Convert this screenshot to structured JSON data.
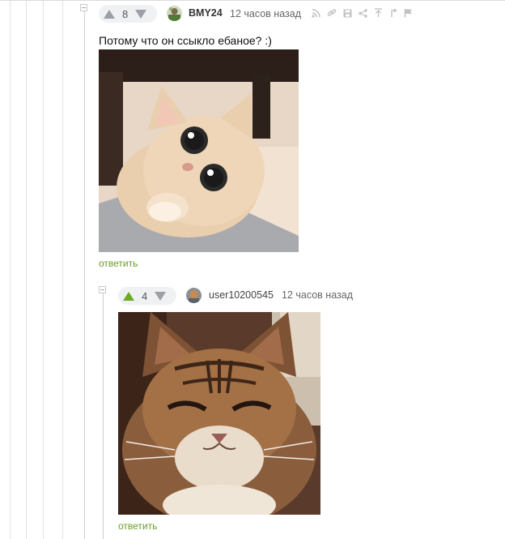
{
  "comments": [
    {
      "rating": "8",
      "username": "BMY24",
      "time": "12 часов назад",
      "text": "Потому что он ссыкло ебаное? :)",
      "image": "photo of a wide-eyed cream kitten peeking from under a chair",
      "reply_label": "ответить"
    },
    {
      "rating": "4",
      "username": "user10200545",
      "time": "12 часов назад",
      "image": "photo of a squinting tabby cat",
      "reply_label": "ответить"
    }
  ],
  "toolbar_icons": [
    "rss-icon",
    "link-icon",
    "save-icon",
    "share-icon",
    "to-parent-icon",
    "to-branch-icon",
    "report-flag-icon"
  ],
  "colors": {
    "accent_green": "#6bab1f",
    "reply_link": "#6a9c2a",
    "rating_bg": "#f0f1f3"
  }
}
